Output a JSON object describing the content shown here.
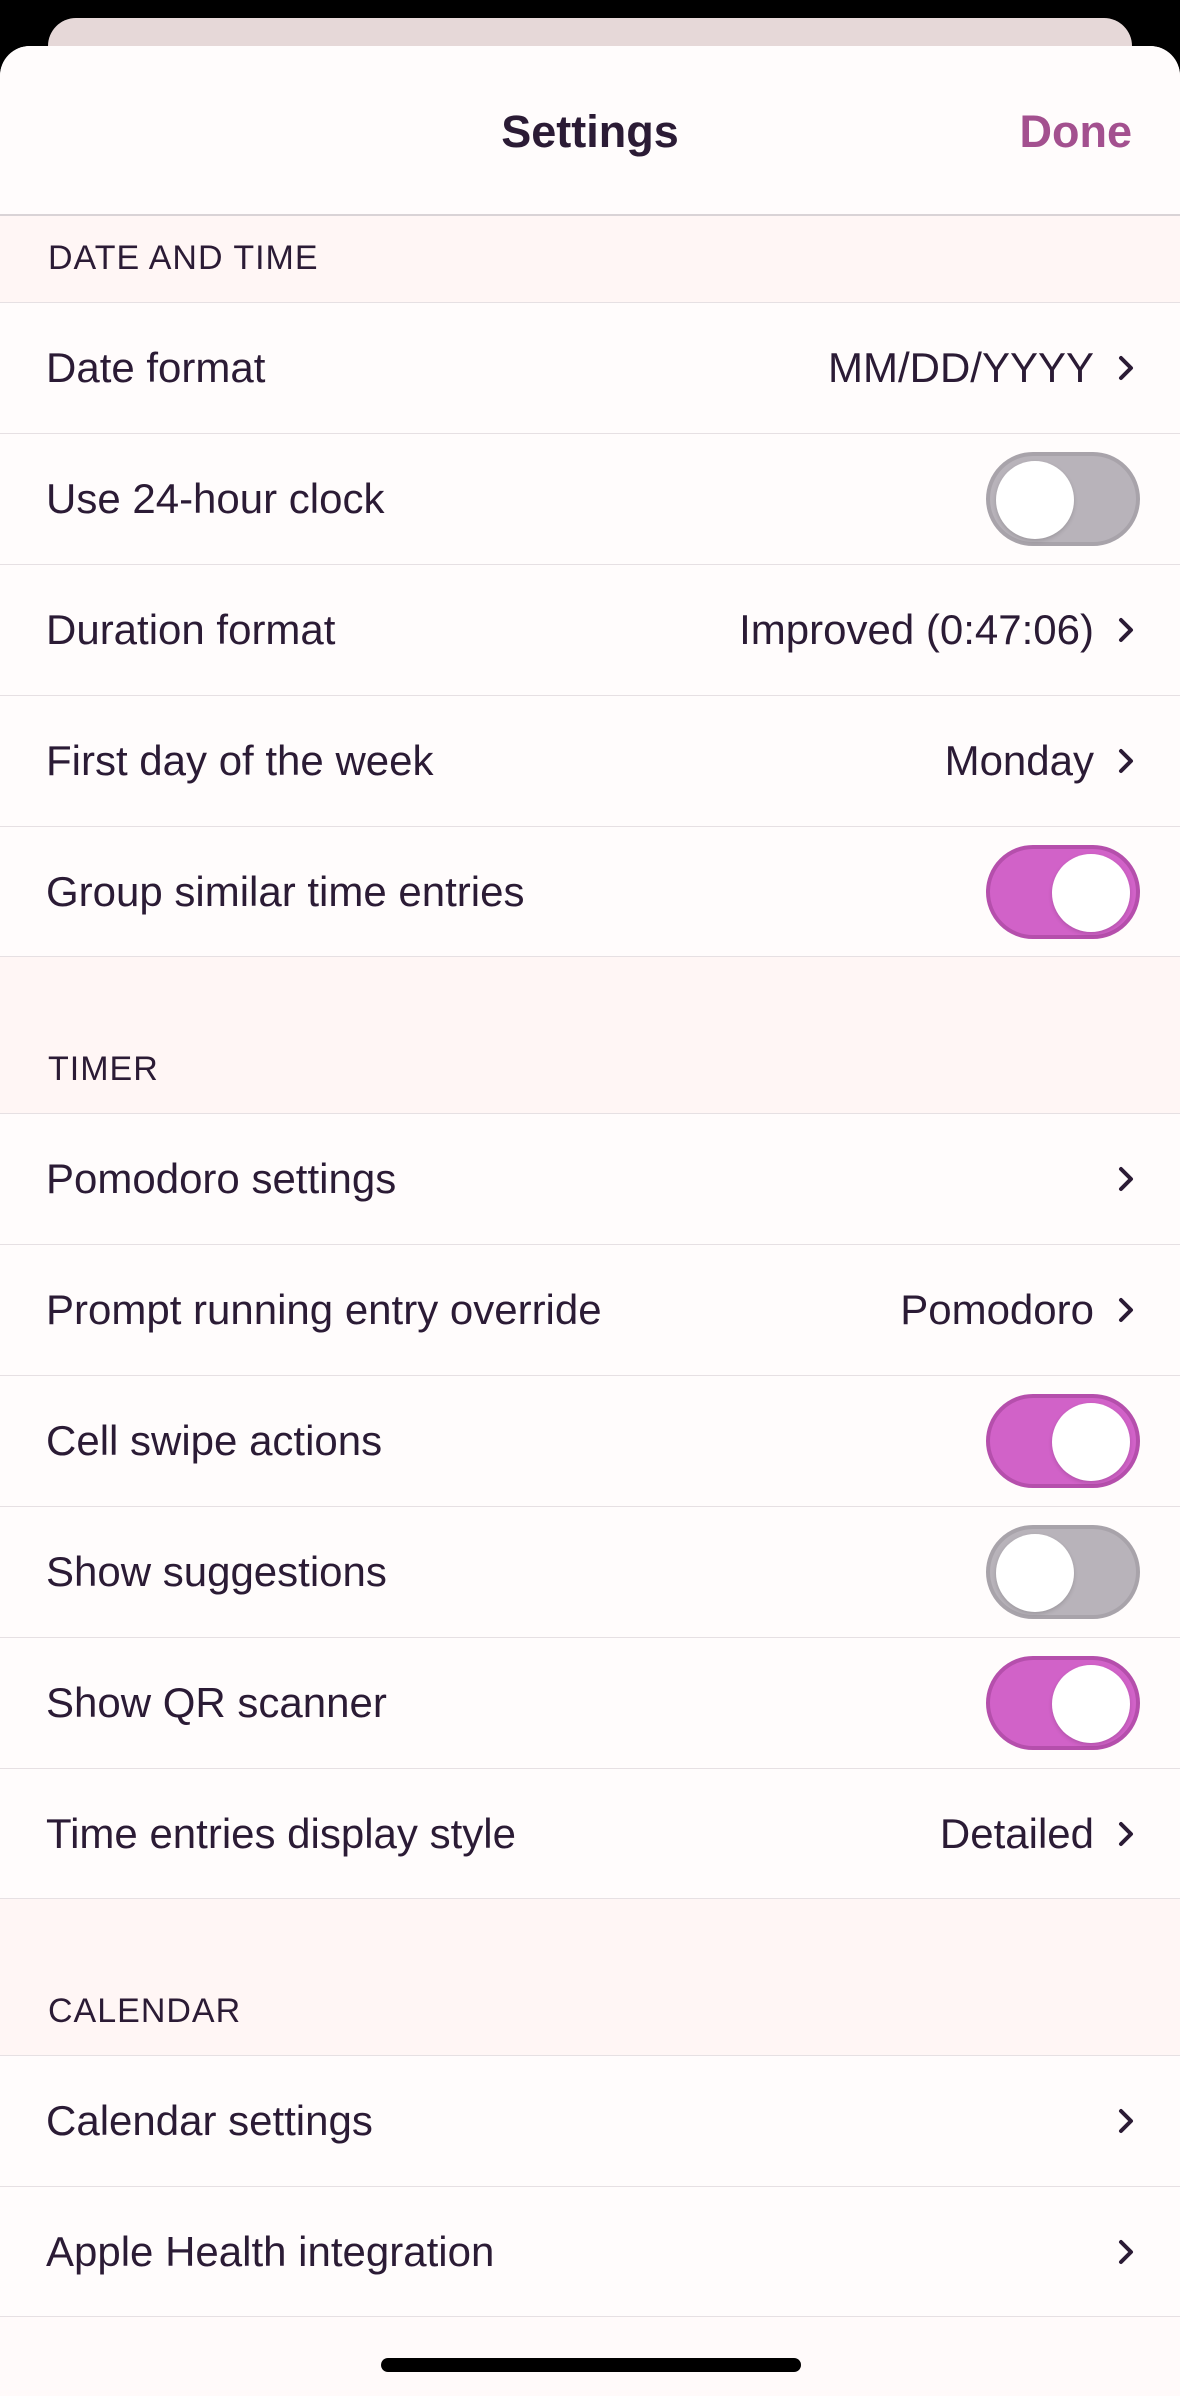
{
  "nav": {
    "title": "Settings",
    "done_label": "Done"
  },
  "sections": {
    "date_time": {
      "header": "DATE AND TIME",
      "date_format": {
        "label": "Date format",
        "value": "MM/DD/YYYY"
      },
      "clock_24h": {
        "label": "Use 24-hour clock",
        "state": "off"
      },
      "duration_format": {
        "label": "Duration format",
        "value": "Improved (0:47:06)"
      },
      "first_day": {
        "label": "First day of the week",
        "value": "Monday"
      },
      "group_similar": {
        "label": "Group similar time entries",
        "state": "on"
      }
    },
    "timer": {
      "header": "TIMER",
      "pomodoro_settings": {
        "label": "Pomodoro settings"
      },
      "prompt_override": {
        "label": "Prompt running entry override",
        "value": "Pomodoro"
      },
      "cell_swipe": {
        "label": "Cell swipe actions",
        "state": "on"
      },
      "show_suggestions": {
        "label": "Show suggestions",
        "state": "off"
      },
      "show_qr": {
        "label": "Show QR scanner",
        "state": "on"
      },
      "display_style": {
        "label": "Time entries display style",
        "value": "Detailed"
      }
    },
    "calendar": {
      "header": "CALENDAR",
      "calendar_settings": {
        "label": "Calendar settings"
      },
      "apple_health": {
        "label": "Apple Health integration"
      }
    }
  },
  "colors": {
    "accent": "#a3508f",
    "toggle_on": "#d162c8",
    "toggle_off": "#b8b3ba",
    "text": "#2b1b35",
    "section_bg": "#fff6f5"
  },
  "icons": {
    "chevron": "chevron-right-icon"
  }
}
